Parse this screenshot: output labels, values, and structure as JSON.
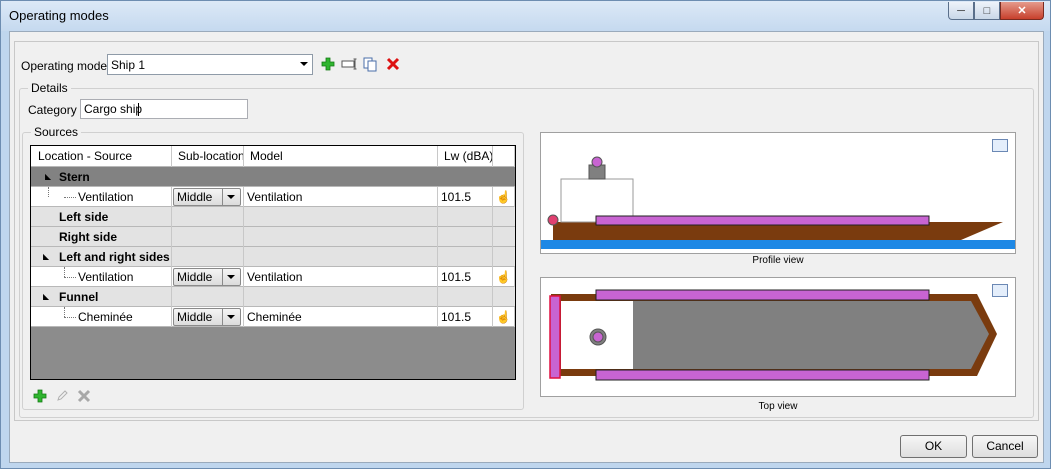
{
  "window": {
    "title": "Operating modes"
  },
  "operating_mode": {
    "label": "Operating mode",
    "value": "Ship 1"
  },
  "details": {
    "title": "Details",
    "category_label": "Category",
    "category_value": "Cargo ship"
  },
  "sources": {
    "title": "Sources",
    "columns": [
      "Location - Source",
      "Sub-location",
      "Model",
      "Lw (dBA)"
    ],
    "rows": [
      {
        "type": "group",
        "label": "Stern",
        "selected": true
      },
      {
        "type": "child",
        "source": "Ventilation",
        "sublocation": "Middle",
        "model": "Ventilation",
        "lw": "101.5"
      },
      {
        "type": "group",
        "label": "Left side"
      },
      {
        "type": "group",
        "label": "Right side"
      },
      {
        "type": "group",
        "label": "Left and right sides"
      },
      {
        "type": "child",
        "source": "Ventilation",
        "sublocation": "Middle",
        "model": "Ventilation",
        "lw": "101.5"
      },
      {
        "type": "group",
        "label": "Funnel"
      },
      {
        "type": "child",
        "source": "Cheminée",
        "sublocation": "Middle",
        "model": "Cheminée",
        "lw": "101.5"
      }
    ]
  },
  "views": {
    "profile_caption": "Profile view",
    "top_caption": "Top view"
  },
  "buttons": {
    "ok": "OK",
    "cancel": "Cancel"
  },
  "colors": {
    "hull": "#7a3b0e",
    "tank": "#c864d2",
    "water": "#1e88e5",
    "deck": "#808080",
    "source": "#c864d2"
  }
}
